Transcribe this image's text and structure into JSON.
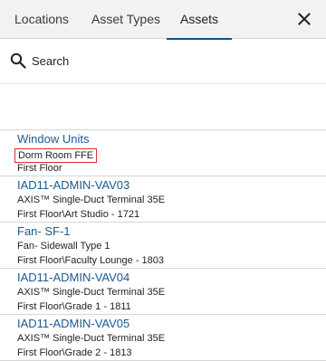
{
  "tabs": [
    {
      "label": "Locations",
      "active": false
    },
    {
      "label": "Asset Types",
      "active": false
    },
    {
      "label": "Assets",
      "active": true
    }
  ],
  "close_icon": "close-icon",
  "search": {
    "icon": "search-icon",
    "label": "Search"
  },
  "colors": {
    "tab_bar_bg": "#f2f2f2",
    "accent_underline": "#1c4f78",
    "link_title": "#1c5a92",
    "highlight_box": "#d93030"
  },
  "assets": [
    {
      "title": "Window Units",
      "type": "Dorm Room FFE",
      "location": "First Floor",
      "type_highlighted": true
    },
    {
      "title": "IAD11-ADMIN-VAV03",
      "type": "AXIS™ Single-Duct Terminal 35E",
      "location": "First Floor\\Art Studio - 1721",
      "type_highlighted": false
    },
    {
      "title": "Fan- SF-1",
      "type": "Fan- Sidewall Type 1",
      "location": "First Floor\\Faculty Lounge - 1803",
      "type_highlighted": false
    },
    {
      "title": "IAD11-ADMIN-VAV04",
      "type": "AXIS™ Single-Duct Terminal 35E",
      "location": "First Floor\\Grade 1 - 1811",
      "type_highlighted": false
    },
    {
      "title": "IAD11-ADMIN-VAV05",
      "type": "AXIS™ Single-Duct Terminal 35E",
      "location": "First Floor\\Grade 2 - 1813",
      "type_highlighted": false
    }
  ]
}
